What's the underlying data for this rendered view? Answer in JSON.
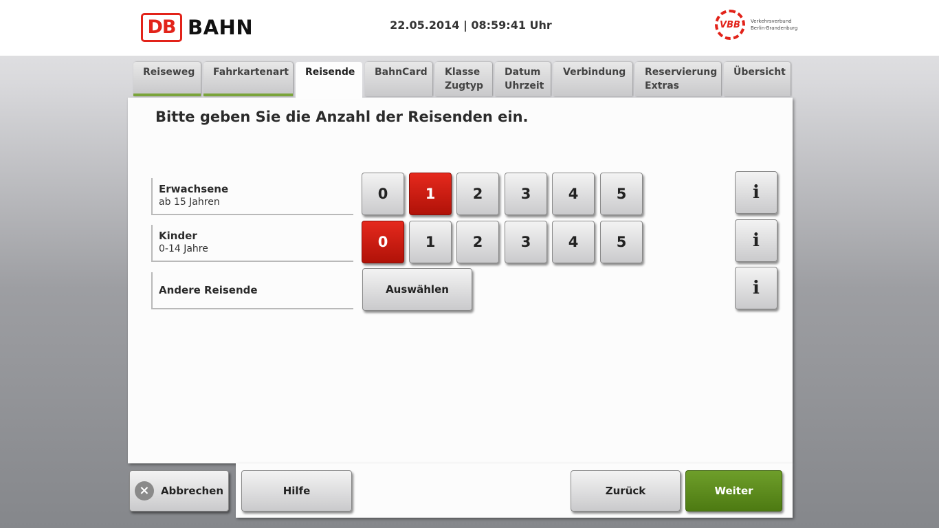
{
  "header": {
    "db_logo": "DB",
    "bahn": "BAHN",
    "datetime": "22.05.2014 | 08:59:41 Uhr",
    "vbb_logo": "VBB",
    "vbb_line1": "Verkehrsverbund",
    "vbb_line2": "Berlin-Brandenburg"
  },
  "tabs": [
    {
      "l1": "Reiseweg",
      "l2": ""
    },
    {
      "l1": "Fahrkartenart",
      "l2": ""
    },
    {
      "l1": "Reisende",
      "l2": ""
    },
    {
      "l1": "BahnCard",
      "l2": ""
    },
    {
      "l1": "Klasse",
      "l2": "Zugtyp"
    },
    {
      "l1": "Datum",
      "l2": "Uhrzeit"
    },
    {
      "l1": "Verbindung",
      "l2": ""
    },
    {
      "l1": "Reservierung",
      "l2": "Extras"
    },
    {
      "l1": "Übersicht",
      "l2": ""
    }
  ],
  "heading": "Bitte geben Sie die Anzahl der Reisenden ein.",
  "rows": {
    "adults": {
      "label": "Erwachsene",
      "sub": "ab 15 Jahren",
      "selected": 1
    },
    "children": {
      "label": "Kinder",
      "sub": "0-14 Jahre",
      "selected": 0
    },
    "other": {
      "label": "Andere Reisende",
      "button": "Auswählen"
    }
  },
  "numbers": [
    "0",
    "1",
    "2",
    "3",
    "4",
    "5"
  ],
  "info_icon": "i",
  "footer": {
    "cancel": "Abbrechen",
    "cancel_icon": "×",
    "help": "Hilfe",
    "back": "Zurück",
    "next": "Weiter"
  },
  "colors": {
    "selected": "#d9231a",
    "next": "#5e8c1e",
    "brand": "#e2231a"
  }
}
